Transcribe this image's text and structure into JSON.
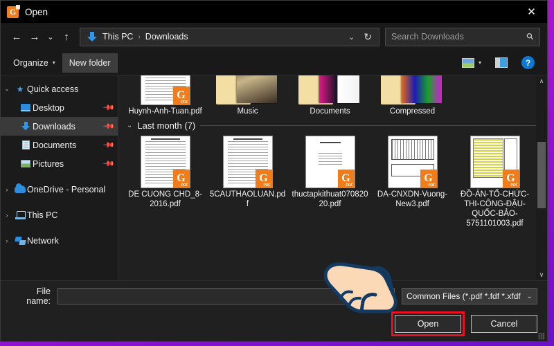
{
  "window": {
    "title": "Open",
    "app_icon": "gaaiho-pdf-icon",
    "close_label": "✕"
  },
  "address_bar": {
    "back": "←",
    "forward": "→",
    "recent": "⌄",
    "up": "↑",
    "location_icon": "downloads-arrow-icon",
    "breadcrumbs": [
      "This PC",
      "Downloads"
    ],
    "separator": "›",
    "dropdown": "⌄",
    "refresh": "↻",
    "search_placeholder": "Search Downloads",
    "search_value": "",
    "search_icon": "search-icon"
  },
  "toolbar": {
    "organize_label": "Organize",
    "organize_caret": "▾",
    "new_folder_label": "New folder",
    "view_icon": "view-layout-icon",
    "view_caret": "▾",
    "preview_pane_icon": "preview-pane-icon",
    "help_label": "?"
  },
  "sidebar": {
    "items": [
      {
        "label": "Quick access",
        "icon": "star-icon",
        "level": 1,
        "chevron": "⌄",
        "pinned": false,
        "selected": false
      },
      {
        "label": "Desktop",
        "icon": "desktop-icon",
        "level": 2,
        "chevron": "",
        "pinned": true,
        "selected": false
      },
      {
        "label": "Downloads",
        "icon": "downloads-icon",
        "level": 2,
        "chevron": "",
        "pinned": true,
        "selected": true
      },
      {
        "label": "Documents",
        "icon": "documents-icon",
        "level": 2,
        "chevron": "",
        "pinned": true,
        "selected": false
      },
      {
        "label": "Pictures",
        "icon": "pictures-icon",
        "level": 2,
        "chevron": "",
        "pinned": true,
        "selected": false
      },
      {
        "label": "OneDrive - Personal",
        "icon": "cloud-icon",
        "level": 1,
        "chevron": "›",
        "pinned": false,
        "selected": false
      },
      {
        "label": "This PC",
        "icon": "pc-icon",
        "level": 1,
        "chevron": "›",
        "pinned": false,
        "selected": false
      },
      {
        "label": "Network",
        "icon": "network-icon",
        "level": 1,
        "chevron": "›",
        "pinned": false,
        "selected": false
      }
    ],
    "pin_glyph": "📌"
  },
  "content": {
    "row_top": [
      {
        "name": "Huynh-Anh-Tuan.pdf",
        "kind": "pdf"
      },
      {
        "name": "Music",
        "kind": "folder"
      },
      {
        "name": "Documents",
        "kind": "folder"
      },
      {
        "name": "Compressed",
        "kind": "folder"
      }
    ],
    "group": {
      "label": "Last month (7)",
      "chevron": "⌄"
    },
    "row_last_month": [
      {
        "name": "DE CUONG CHD_8-2016.pdf",
        "kind": "pdf"
      },
      {
        "name": "5CAUTHAOLUAN.pdf",
        "kind": "pdf"
      },
      {
        "name": "thuctapkithuat07082020.pdf",
        "kind": "pdf"
      },
      {
        "name": "DA-CNXDN-Vuong-New3.pdf",
        "kind": "pdf"
      },
      {
        "name": "ĐỒ-ÁN-TỔ-CHỨC-THI-CÔNG-ĐẬU-QUỐC-BẢO-5751101003.pdf",
        "kind": "pdf"
      }
    ],
    "pdf_badge_letter": "G",
    "pdf_badge_label": "PDF",
    "scroll_up": "∧",
    "scroll_down": "∨"
  },
  "bottom": {
    "file_name_label": "File name:",
    "file_name_value": "",
    "file_type_value": "Common Files (*.pdf *.fdf *.xfdf",
    "file_type_caret": "⌄",
    "open_label": "Open",
    "cancel_label": "Cancel"
  },
  "annotation": {
    "hand_cursor": "pointing-hand-cursor",
    "highlight_color": "#e81123"
  }
}
